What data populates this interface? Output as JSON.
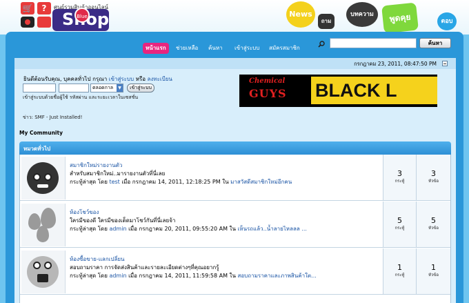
{
  "logo": {
    "tagline": "ศูนย์รวมสินค้าออนไลน์",
    "blue_badge": "Blue",
    "wordmark": "Shop",
    "q_mark": "?"
  },
  "bubbles": {
    "news": "News",
    "ask": "ถาม",
    "article": "บทความ",
    "talk": "พูดคุย",
    "answer": "ตอบ"
  },
  "nav": {
    "items": [
      {
        "label": "หน้าแรก",
        "active": true
      },
      {
        "label": "ช่วยเหลือ",
        "active": false
      },
      {
        "label": "ค้นหา",
        "active": false
      },
      {
        "label": "เข้าสู่ระบบ",
        "active": false
      },
      {
        "label": "สมัครสมาชิก",
        "active": false
      }
    ]
  },
  "search": {
    "value": "",
    "button_label": "ค้นหา",
    "icon": "magnifier-icon"
  },
  "datebar": {
    "date": "กรกฎาคม 23, 2011, 08:47:50 PM"
  },
  "login": {
    "welcome_prefix": "ยินดีต้อนรับคุณ, บุคคลทั่วไป กรุณา",
    "login_link": "เข้าสู่ระบบ",
    "or": "หรือ",
    "register_link": "ลงทะเบียน",
    "username": "",
    "password": "",
    "duration": "ตลอดกาล",
    "button_label": "เข้าสู่ระบบ",
    "hint": "เข้าสู่ระบบด้วยชื่อผู้ใช้ รหัสผ่าน และระยะเวลาในเซสชั่น"
  },
  "news": {
    "line": "ข่าว: SMF - Just Installed!"
  },
  "banner": {
    "line1": "Chemical",
    "line2": "GUYS",
    "line3": "BLACK L"
  },
  "community": {
    "title": "My Community"
  },
  "category": {
    "title": "หมวดทั่วไป"
  },
  "boards": [
    {
      "title": "สมาชิกใหม่รายงานตัว",
      "description": "สำหรับสมาชิกใหม่..มารายงานตัวที่นี่เลย",
      "last_prefix": "กระทู้ล่าสุด โดย",
      "last_user": "test",
      "last_when": "เมื่อ กรกฎาคม 14, 2011, 12:18:25 PM ใน",
      "last_topic": "มาสวัสดีสมาชิกใหม่อีกคน",
      "posts": "3",
      "posts_label": "กระทู้",
      "topics": "3",
      "topics_label": "หัวข้อ"
    },
    {
      "title": "ห้องโชว์ของ",
      "description": "ใครมีของดี ใครมีของเด็ดมาโชว์กันที่นี่เลยจ้า",
      "last_prefix": "กระทู้ล่าสุด โดย",
      "last_user": "admin",
      "last_when": "เมื่อ กรกฎาคม 20, 2011, 09:55:20 AM ใน",
      "last_topic": "เห็นรถแล้ว..น้ำลายไหลลล ...",
      "posts": "5",
      "posts_label": "กระทู้",
      "topics": "5",
      "topics_label": "หัวข้อ"
    },
    {
      "title": "ห้องซื้อขาย-แลกเปลี่ยน",
      "description": "สอบถามราคา การจัดส่งสินค้าและรายละเอียดต่างๆที่คุณอยากรู้",
      "last_prefix": "กระทู้ล่าสุด โดย",
      "last_user": "admin",
      "last_when": "เมื่อ กรกฎาคม 14, 2011, 11:59:58 AM ใน",
      "last_topic": "สอบถามราคาและภาพสินค้าใต...",
      "posts": "1",
      "posts_label": "กระทู้",
      "topics": "1",
      "topics_label": "หัวข้อ"
    }
  ]
}
